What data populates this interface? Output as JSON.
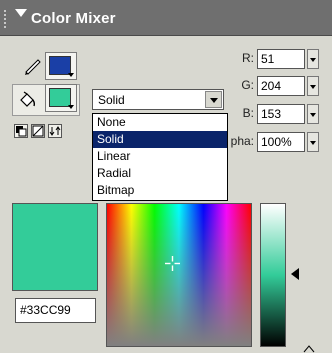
{
  "panel": {
    "title": "Color Mixer"
  },
  "stroke": {
    "color": "#1a3fa6"
  },
  "fill": {
    "color": "#33cc99",
    "type_value": "Solid",
    "type_options": [
      "None",
      "Solid",
      "Linear",
      "Radial",
      "Bitmap"
    ],
    "selected_option": "Solid"
  },
  "rgb": {
    "r_label": "R:",
    "r_value": "51",
    "g_label": "G:",
    "g_value": "204",
    "b_label": "B:",
    "b_value": "153",
    "alpha_label": "pha:",
    "alpha_value": "100%"
  },
  "preview": {
    "hex": "#33CC99"
  },
  "colors": {
    "header_bg": "#6f6f6f",
    "selection": "#0a246a",
    "stroke_swatch": "#1a3fa6",
    "fill_swatch": "#33cc99"
  }
}
